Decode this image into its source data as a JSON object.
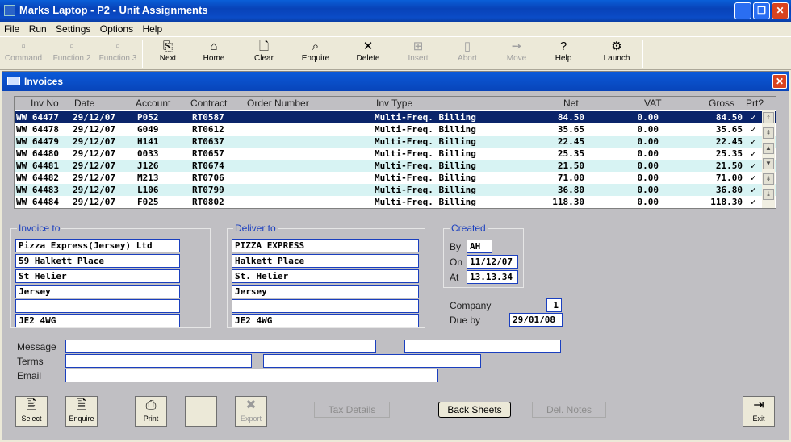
{
  "window": {
    "title": "Marks Laptop - P2 - Unit Assignments"
  },
  "menu": [
    "File",
    "Run",
    "Settings",
    "Options",
    "Help"
  ],
  "toolbar": [
    {
      "label": "Command",
      "icon": "command-icon",
      "glyph": "▫",
      "enabled": false
    },
    {
      "label": "Function 2",
      "icon": "function-icon",
      "glyph": "▫",
      "enabled": false
    },
    {
      "label": "Function 3",
      "icon": "function-icon",
      "glyph": "▫",
      "enabled": false
    },
    {
      "label": "Next",
      "icon": "next-icon",
      "glyph": "⎘",
      "enabled": true
    },
    {
      "label": "Home",
      "icon": "home-icon",
      "glyph": "⌂",
      "enabled": true
    },
    {
      "label": "Clear",
      "icon": "clear-icon",
      "glyph": "🗋",
      "enabled": true
    },
    {
      "label": "Enquire",
      "icon": "search-icon",
      "glyph": "⌕",
      "enabled": true
    },
    {
      "label": "Delete",
      "icon": "delete-icon",
      "glyph": "✕",
      "enabled": true
    },
    {
      "label": "Insert",
      "icon": "insert-icon",
      "glyph": "⊞",
      "enabled": false
    },
    {
      "label": "Abort",
      "icon": "abort-icon",
      "glyph": "▯",
      "enabled": false
    },
    {
      "label": "Move",
      "icon": "move-icon",
      "glyph": "➙",
      "enabled": false
    },
    {
      "label": "Help",
      "icon": "help-icon",
      "glyph": "?",
      "enabled": true
    },
    {
      "label": "Launch",
      "icon": "launch-icon",
      "glyph": "⚙",
      "enabled": true
    }
  ],
  "invoices": {
    "title": "Invoices",
    "columns": [
      "Inv No",
      "Date",
      "Account",
      "Contract",
      "Order Number",
      "Inv Type",
      "Net",
      "VAT",
      "Gross",
      "Prt?"
    ],
    "rows": [
      {
        "inv": "WW 64477",
        "date": "29/12/07",
        "account": "P052",
        "contract": "RT0587",
        "order": "",
        "type": "Multi-Freq. Billing",
        "net": "84.50",
        "vat": "0.00",
        "gross": "84.50",
        "prt": "✓",
        "selected": true
      },
      {
        "inv": "WW 64478",
        "date": "29/12/07",
        "account": "G049",
        "contract": "RT0612",
        "order": "",
        "type": "Multi-Freq. Billing",
        "net": "35.65",
        "vat": "0.00",
        "gross": "35.65",
        "prt": "✓",
        "selected": false
      },
      {
        "inv": "WW 64479",
        "date": "29/12/07",
        "account": "H141",
        "contract": "RT0637",
        "order": "",
        "type": "Multi-Freq. Billing",
        "net": "22.45",
        "vat": "0.00",
        "gross": "22.45",
        "prt": "✓",
        "selected": false
      },
      {
        "inv": "WW 64480",
        "date": "29/12/07",
        "account": "0033",
        "contract": "RT0657",
        "order": "",
        "type": "Multi-Freq. Billing",
        "net": "25.35",
        "vat": "0.00",
        "gross": "25.35",
        "prt": "✓",
        "selected": false
      },
      {
        "inv": "WW 64481",
        "date": "29/12/07",
        "account": "J126",
        "contract": "RT0674",
        "order": "",
        "type": "Multi-Freq. Billing",
        "net": "21.50",
        "vat": "0.00",
        "gross": "21.50",
        "prt": "✓",
        "selected": false
      },
      {
        "inv": "WW 64482",
        "date": "29/12/07",
        "account": "M213",
        "contract": "RT0706",
        "order": "",
        "type": "Multi-Freq. Billing",
        "net": "71.00",
        "vat": "0.00",
        "gross": "71.00",
        "prt": "✓",
        "selected": false
      },
      {
        "inv": "WW 64483",
        "date": "29/12/07",
        "account": "L106",
        "contract": "RT0799",
        "order": "",
        "type": "Multi-Freq. Billing",
        "net": "36.80",
        "vat": "0.00",
        "gross": "36.80",
        "prt": "✓",
        "selected": false
      },
      {
        "inv": "WW 64484",
        "date": "29/12/07",
        "account": "F025",
        "contract": "RT0802",
        "order": "",
        "type": "Multi-Freq. Billing",
        "net": "118.30",
        "vat": "0.00",
        "gross": "118.30",
        "prt": "✓",
        "selected": false
      }
    ]
  },
  "invoice_to": {
    "label": "Invoice to",
    "lines": [
      "Pizza Express(Jersey) Ltd",
      "59 Halkett Place",
      "St Helier",
      "Jersey",
      "",
      "JE2 4WG"
    ]
  },
  "deliver_to": {
    "label": "Deliver to",
    "lines": [
      "PIZZA EXPRESS",
      "Halkett Place",
      "St. Helier",
      "Jersey",
      "",
      "JE2 4WG"
    ]
  },
  "created": {
    "label": "Created",
    "by_label": "By",
    "by": "AH",
    "on_label": "On",
    "on": "11/12/07",
    "at_label": "At",
    "at": "13.13.34"
  },
  "company": {
    "label": "Company",
    "value": "1"
  },
  "due": {
    "label": "Due by",
    "value": "29/01/08"
  },
  "message": {
    "label": "Message",
    "value1": "",
    "value2": ""
  },
  "terms": {
    "label": "Terms",
    "value1": "",
    "value2": ""
  },
  "email": {
    "label": "Email",
    "value": ""
  },
  "bottom_buttons": {
    "select": "Select",
    "enquire": "Enquire",
    "print": "Print",
    "export": "Export",
    "tax_details": "Tax Details",
    "back_sheets": "Back Sheets",
    "del_notes": "Del. Notes",
    "exit": "Exit"
  },
  "colors": {
    "selection": "#0a246a",
    "accent": "#1a3fbf",
    "row_alt": "#d7f3f3"
  }
}
